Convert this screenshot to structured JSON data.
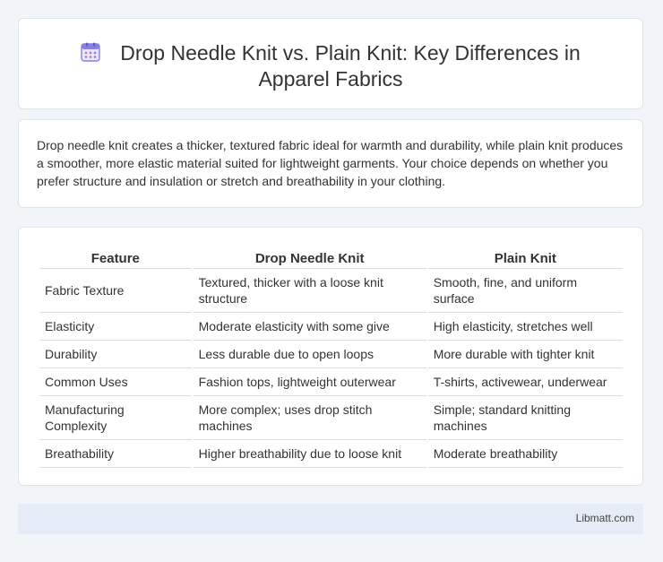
{
  "header": {
    "icon": "calendar-icon",
    "title_line1": "Drop Needle Knit vs. Plain Knit: Key Differences in",
    "title_line2": "Apparel Fabrics",
    "accent_color": "#7b6fd6"
  },
  "summary": {
    "text": "Drop needle knit creates a thicker, textured fabric ideal for warmth and durability, while plain knit produces a smoother, more elastic material suited for lightweight garments. Your choice depends on whether you prefer structure and insulation or stretch and breathability in your clothing."
  },
  "table": {
    "headers": [
      "Feature",
      "Drop Needle Knit",
      "Plain Knit"
    ],
    "rows": [
      [
        "Fabric Texture",
        "Textured, thicker with a loose knit structure",
        "Smooth, fine, and uniform surface"
      ],
      [
        "Elasticity",
        "Moderate elasticity with some give",
        "High elasticity, stretches well"
      ],
      [
        "Durability",
        "Less durable due to open loops",
        "More durable with tighter knit"
      ],
      [
        "Common Uses",
        "Fashion tops, lightweight outerwear",
        "T-shirts, activewear, underwear"
      ],
      [
        "Manufacturing Complexity",
        "More complex; uses drop stitch machines",
        "Simple; standard knitting machines"
      ],
      [
        "Breathability",
        "Higher breathability due to loose knit",
        "Moderate breathability"
      ]
    ]
  },
  "footer": {
    "brand": "Libmatt.com"
  }
}
